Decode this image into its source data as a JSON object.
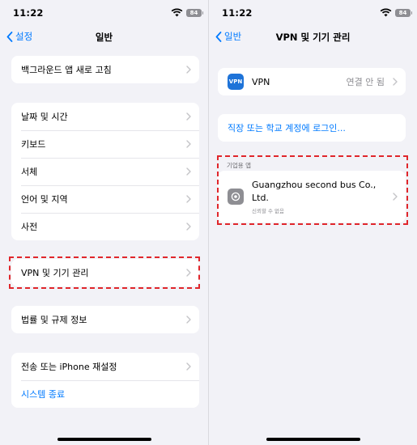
{
  "left": {
    "status": {
      "time": "11:22",
      "battery": "84"
    },
    "nav": {
      "back_label": "설정",
      "title": "일반"
    },
    "groups": [
      {
        "items": [
          "백그라운드 앱 새로 고침"
        ]
      },
      {
        "items": [
          "날짜 및 시간",
          "키보드",
          "서체",
          "언어 및 지역",
          "사전"
        ]
      },
      {
        "items": [
          "VPN 및 기기 관리"
        ]
      },
      {
        "items": [
          "법률 및 규제 정보"
        ]
      },
      {
        "items": [
          "전송 또는 iPhone 재설정",
          "시스템 종료"
        ]
      }
    ]
  },
  "right": {
    "status": {
      "time": "11:22",
      "battery": "84"
    },
    "nav": {
      "back_label": "일반",
      "title": "VPN 및 기기 관리"
    },
    "vpn": {
      "icon_text": "VPN",
      "label": "VPN",
      "value": "연결 안 됨"
    },
    "login_link": "직장 또는 학교 계정에 로그인...",
    "enterprise": {
      "header": "기업용 앱",
      "app_name": "Guangzhou second bus Co., Ltd.",
      "app_status": "신뢰할 수 없음"
    }
  },
  "colors": {
    "accent": "#007aff",
    "highlight": "#e0262b",
    "background": "#f2f2f7",
    "vpn_icon": "#1e73d8"
  },
  "icons": [
    "wifi-icon",
    "battery-icon",
    "chevron-left-icon",
    "chevron-right-icon",
    "gear-icon"
  ]
}
